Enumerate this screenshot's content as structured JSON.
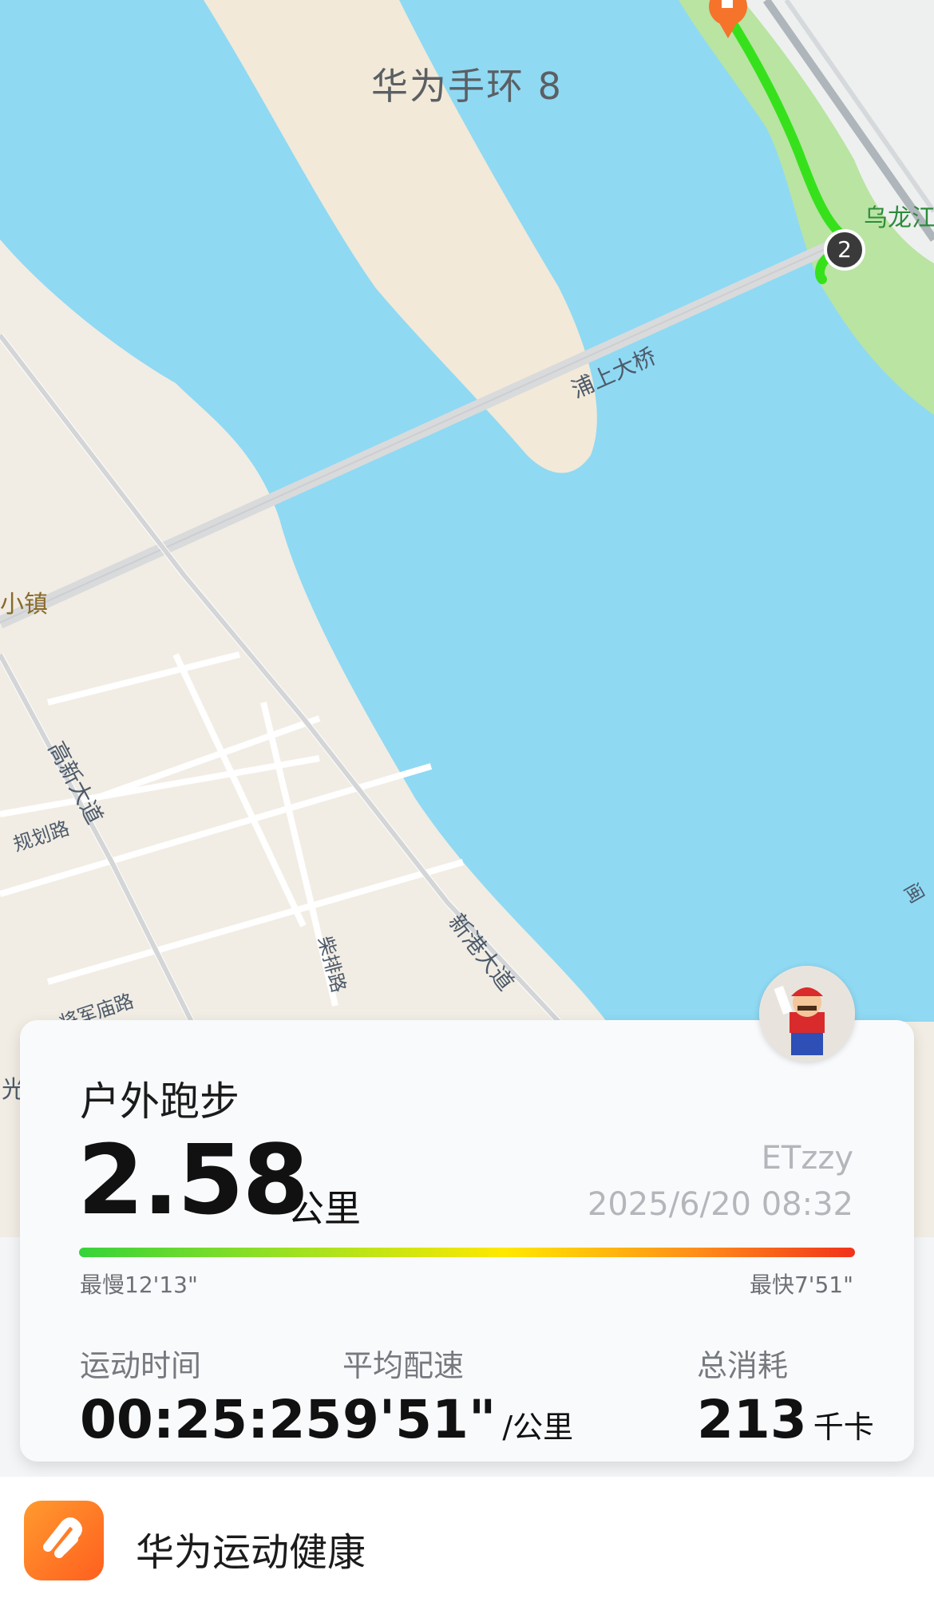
{
  "map": {
    "device_label": "华为手环 8",
    "labels": {
      "wulongjiang": "乌龙江",
      "pushang_bridge": "浦上大桥",
      "xiaozhen": "小镇",
      "gaoxin_avenue": "高新大道",
      "guihua_road": "规划路",
      "chaipai_road": "柴排路",
      "xingang_avenue": "新港大道",
      "jiangjunmiao_road": "将军庙路",
      "guang": "光",
      "min": "闽"
    },
    "marker_number": "2",
    "colors": {
      "water": "#8fd9f3",
      "land": "#f1ede4",
      "sandbar": "#f2e9d9",
      "park": "#b9e4a2",
      "route": "#36e11c",
      "start_marker": "#f5732b"
    }
  },
  "card": {
    "activity_type": "户外跑步",
    "distance_value": "2.58",
    "distance_unit": "公里",
    "user_name": "ETzzy",
    "date_time": "2025/6/20 08:32",
    "pace_slowest": "最慢12'13\"",
    "pace_fastest": "最快7'51\"",
    "stats": {
      "duration": {
        "label": "运动时间",
        "value": "00:25:25"
      },
      "avg_pace": {
        "label": "平均配速",
        "value": "9'51\"",
        "unit": "/公里"
      },
      "calories": {
        "label": "总消耗",
        "value": "213",
        "unit": "千卡"
      }
    },
    "avatar_icon": "mario-avatar"
  },
  "footer": {
    "app_icon": "huawei-health-icon",
    "app_name": "华为运动健康"
  }
}
